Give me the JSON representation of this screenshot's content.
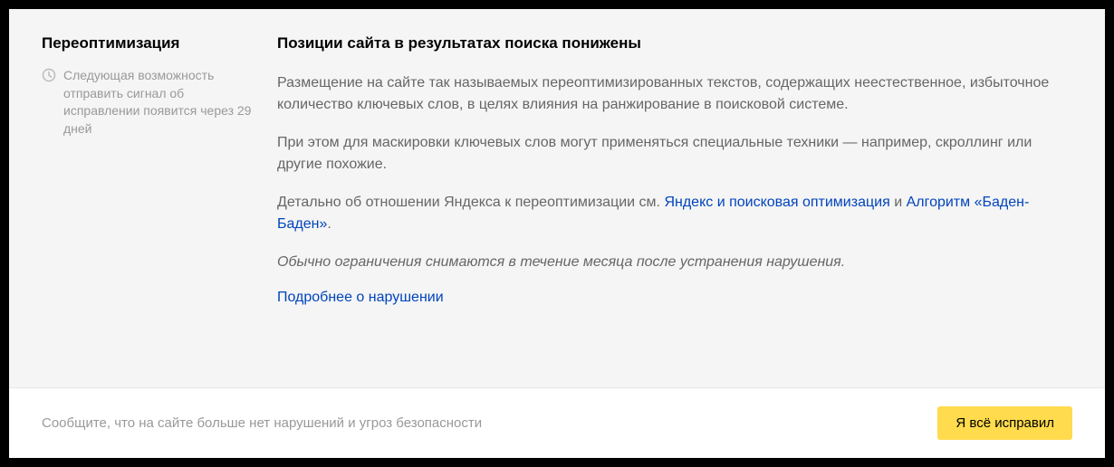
{
  "sidebar": {
    "title": "Переоптимизация",
    "info_text": "Следующая возможность отправить сигнал об исправлении появится через 29 дней"
  },
  "main": {
    "title": "Позиции сайта в результатах поиска понижены",
    "paragraph1": "Размещение на сайте так называемых переоптимизированных текстов, содержащих неестественное, избыточное количество ключевых слов, в целях влияния на ранжирование в поисковой системе.",
    "paragraph2": "При этом для маскировки ключевых слов могут применяться специальные техники — например, скроллинг или другие похожие.",
    "paragraph3_prefix": "Детально об отношении Яндекса к переоптимизации см. ",
    "link1": "Яндекс и поисковая оптимизация",
    "paragraph3_mid": " и ",
    "link2": "Алгоритм «Баден-Баден»",
    "paragraph3_suffix": ".",
    "paragraph4": "Обычно ограничения снимаются в течение месяца после устранения нарушения.",
    "more_link": "Подробнее о нарушении"
  },
  "footer": {
    "text": "Сообщите, что на сайте больше нет нарушений и угроз безопасности",
    "button_label": "Я всё исправил"
  }
}
